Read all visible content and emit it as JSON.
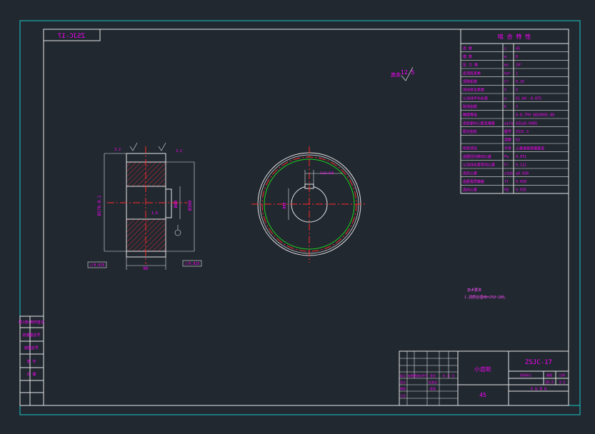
{
  "colors": {
    "background": "#212830",
    "frame": "#19c9c9",
    "border": "#e6e6e6",
    "text": "#ff00ff",
    "center_line": "#ff2a2a",
    "green": "#1bd61b",
    "hatch": "#ff2a2a",
    "note": "#ff4dff"
  },
  "header": {
    "code_mirrored": "ZSJC-17",
    "roughness_prefix": "其余",
    "roughness_value": "12.5"
  },
  "table": {
    "title": "啮 合 特 性",
    "rows": [
      {
        "label": "齿 数",
        "sym": "z",
        "value": "45"
      },
      {
        "label": "模 数",
        "sym": "m",
        "value": "8"
      },
      {
        "label": "压 力 角",
        "sym": "αn",
        "value": "20°"
      },
      {
        "label": "齿顶高系数",
        "sym": "ha*",
        "value": "1"
      },
      {
        "label": "顶隙系数",
        "sym": "C*",
        "value": "0.25"
      },
      {
        "label": "径向变位系数",
        "sym": "X",
        "value": "0"
      },
      {
        "label": "公法线平均长度",
        "sym": "w",
        "value": "61.84 -0.075"
      },
      {
        "label": "跨测齿数",
        "sym": "K",
        "value": "3"
      },
      {
        "label": "精度等级",
        "sym": "",
        "value": "8-8-7FH GB10095-88"
      },
      {
        "label": "齿轮副中心距及偏差",
        "sym": "a±fa",
        "value": "432±0.0485"
      },
      {
        "label": "配对齿轮",
        "sym": "图号",
        "value": "ZSJC-3"
      },
      {
        "label": "",
        "sym": "齿数",
        "value": "63"
      },
      {
        "label": "检验项目",
        "sym": "代号",
        "value": "公差或极限偏差值"
      },
      {
        "label": "齿圈径向跳动公差",
        "sym": "Fw",
        "value": "0.071"
      },
      {
        "label": "公法线长度变动公差",
        "sym": "Fr",
        "value": "0.112"
      },
      {
        "label": "齿形公差",
        "sym": "±fpb",
        "value": "±0.030"
      },
      {
        "label": "齿距极限偏差",
        "sym": "ff",
        "value": "0.028"
      },
      {
        "label": "齿向公差",
        "sym": "Fβ",
        "value": "0.035"
      }
    ]
  },
  "front_view": {
    "dim_outer": "Ø376-0.1",
    "dim_bore": "Ø80",
    "dim_hub": "Ø300",
    "dim_width": "80",
    "gd_left": "//0.015",
    "gd_right": "//0.015",
    "rough_small": "3.2",
    "rough_bore": "1.6"
  },
  "side_view": {
    "keyway_note": "22±0.026",
    "bore_note": "Ø80"
  },
  "notes": {
    "title": "技术要求",
    "body": "1.调质处理HB=250~280。"
  },
  "title_block": {
    "part_name": "小齿轮",
    "drawing_no": "ZSJC-17",
    "material": "45",
    "header_labels": [
      "阶段标记",
      "重量",
      "比例"
    ],
    "weight": "18.5",
    "scale": "1:2",
    "sheet": "共 张 第 张",
    "sign_labels": [
      "标记",
      "处数",
      "更改文件号",
      "签名",
      "年 月 日"
    ],
    "role_labels": [
      "设计",
      "审核",
      "工艺",
      "标准化",
      "批准"
    ]
  },
  "left_strip": [
    "借(通)用件登记",
    "旧底图总号",
    "底图总号",
    "签 字",
    "日 期"
  ]
}
